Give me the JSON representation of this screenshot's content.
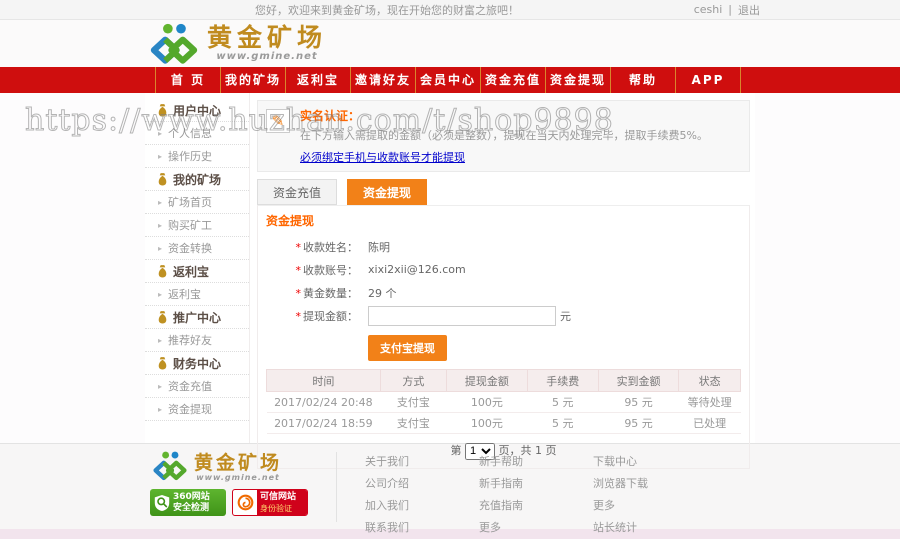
{
  "topbar": {
    "welcome": "您好，欢迎来到黄金矿场，现在开始您的财富之旅吧！",
    "username": "ceshi",
    "divider": "|",
    "logout": "退出"
  },
  "logo": {
    "title": "黄金矿场",
    "url": "www.gmine.net"
  },
  "nav": {
    "items": [
      "首 页",
      "我的矿场",
      "返利宝",
      "邀请好友",
      "会员中心",
      "资金充值",
      "资金提现",
      "帮助",
      "APP"
    ]
  },
  "sidebar": {
    "sections": [
      {
        "title": "用户中心",
        "items": [
          "个人信息",
          "操作历史"
        ]
      },
      {
        "title": "我的矿场",
        "items": [
          "矿场首页",
          "购买矿工",
          "资金转换"
        ]
      },
      {
        "title": "返利宝",
        "items": [
          "返利宝"
        ]
      },
      {
        "title": "推广中心",
        "items": [
          "推荐好友"
        ]
      },
      {
        "title": "财务中心",
        "items": [
          "资金充值",
          "资金提现"
        ]
      }
    ]
  },
  "notice": {
    "title": "实名认证：",
    "line": "在下方输入需提取的金额（必须是整数），提现在当天内处理完毕，提取手续费5%。",
    "link": "必须绑定手机与收款账号才能提现"
  },
  "tabs": [
    "资金充值",
    "资金提现"
  ],
  "panel": {
    "section_title": "资金提现",
    "form": {
      "fields": [
        {
          "label": "收款姓名：",
          "value": "陈明"
        },
        {
          "label": "收款账号：",
          "value": "xixi2xii@126.com"
        },
        {
          "label": "黄金数量：",
          "value": "29 个"
        },
        {
          "label": "提现金额：",
          "value": ""
        }
      ],
      "unit": "元",
      "submit": "支付宝提现"
    }
  },
  "table": {
    "headers": [
      "时间",
      "方式",
      "提现金额",
      "手续费",
      "实到金额",
      "状态"
    ],
    "rows": [
      [
        "2017/02/24 20:48",
        "支付宝",
        "100元",
        "5 元",
        "95 元",
        "等待处理"
      ],
      [
        "2017/02/24 18:59",
        "支付宝",
        "100元",
        "5 元",
        "95 元",
        "已处理"
      ]
    ]
  },
  "pagination": {
    "prefix": "第",
    "page": "1",
    "suffix": "页，共 1 页"
  },
  "footer": {
    "links": [
      [
        "关于我们",
        "公司介绍",
        "加入我们",
        "联系我们"
      ],
      [
        "新手帮助",
        "新手指南",
        "充值指南",
        "更多"
      ],
      [
        "下载中心",
        "浏览器下载",
        "更多",
        "站长统计"
      ]
    ],
    "badge_360": {
      "line1": "360网站",
      "line2": "安全检测"
    },
    "badge_trust": {
      "line1": "可信网站",
      "line2": "身份验证"
    }
  },
  "watermark": "https://www.huzhan.com/t/shop9898",
  "ui": {
    "asterisk": "*",
    "arrow": "▸",
    "pencil": "✎"
  },
  "colors": {
    "nav_red": "#cf0e0e",
    "accent_orange": "#f28118",
    "logo_gold": "#c08b1f",
    "link_blue": "#0000cc",
    "badge_green": "#3f9318",
    "badge_red": "#d0021b"
  }
}
